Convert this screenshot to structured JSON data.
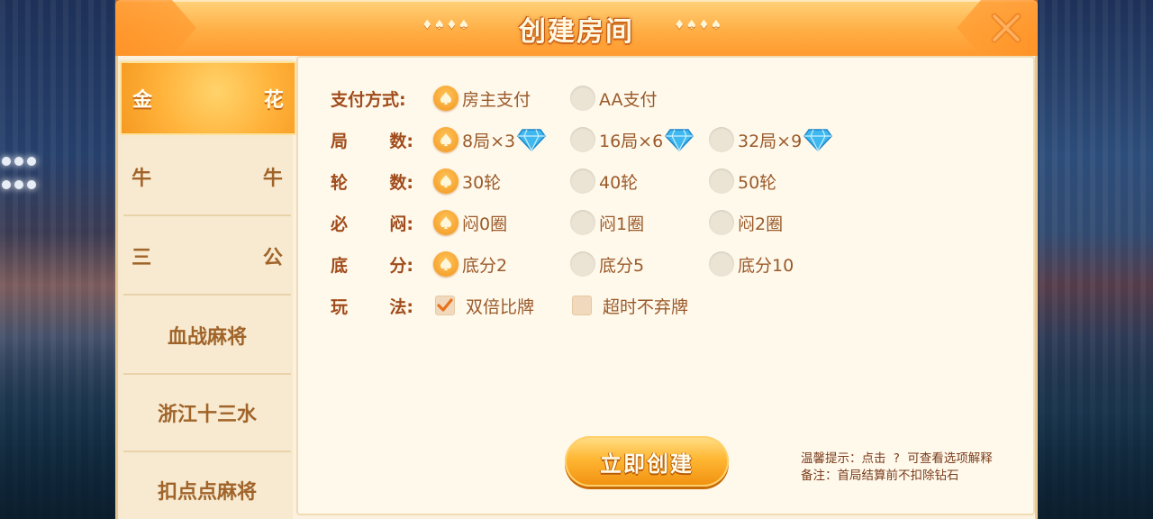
{
  "title": "创建房间",
  "title_deco": "♦♠♦♠",
  "sidebar": {
    "items": [
      {
        "label": "金 花",
        "active": true
      },
      {
        "label": "牛 牛",
        "active": false
      },
      {
        "label": "三 公",
        "active": false
      },
      {
        "label": "血战麻将",
        "active": false
      },
      {
        "label": "浙江十三水",
        "active": false
      },
      {
        "label": "扣点点麻将",
        "active": false
      }
    ]
  },
  "options": {
    "payment": {
      "label": "支付方式:",
      "choices": [
        {
          "text": "房主支付",
          "selected": true
        },
        {
          "text": "AA支付",
          "selected": false
        }
      ]
    },
    "rounds": {
      "label_a": "局",
      "label_b": "数:",
      "choices": [
        {
          "text": "8局×3",
          "selected": true,
          "icon": "diamond-icon"
        },
        {
          "text": "16局×6",
          "selected": false,
          "icon": "diamond-icon"
        },
        {
          "text": "32局×9",
          "selected": false,
          "icon": "diamond-icon"
        }
      ]
    },
    "turns": {
      "label_a": "轮",
      "label_b": "数:",
      "choices": [
        {
          "text": "30轮",
          "selected": true
        },
        {
          "text": "40轮",
          "selected": false
        },
        {
          "text": "50轮",
          "selected": false
        }
      ]
    },
    "must_blind": {
      "label_a": "必",
      "label_b": "闷:",
      "choices": [
        {
          "text": "闷0圈",
          "selected": true
        },
        {
          "text": "闷1圈",
          "selected": false
        },
        {
          "text": "闷2圈",
          "selected": false
        }
      ]
    },
    "base_score": {
      "label_a": "底",
      "label_b": "分:",
      "choices": [
        {
          "text": "底分2",
          "selected": true
        },
        {
          "text": "底分5",
          "selected": false
        },
        {
          "text": "底分10",
          "selected": false
        }
      ]
    },
    "play_mode": {
      "label_a": "玩",
      "label_b": "法:",
      "choices": [
        {
          "text": "双倍比牌",
          "checked": true
        },
        {
          "text": "超时不弃牌",
          "checked": false
        }
      ]
    }
  },
  "create_button": "立即创建",
  "tips": {
    "line1_prefix": "温馨提示：点击",
    "line1_q": "?",
    "line1_suffix": "可查看选项解释",
    "line2": "备注：首局结算前不扣除钻石"
  },
  "colors": {
    "accent": "#f2961f",
    "label": "#a04b1a",
    "option_text": "#9a5a2a",
    "diamond": "#3fb8f0"
  }
}
